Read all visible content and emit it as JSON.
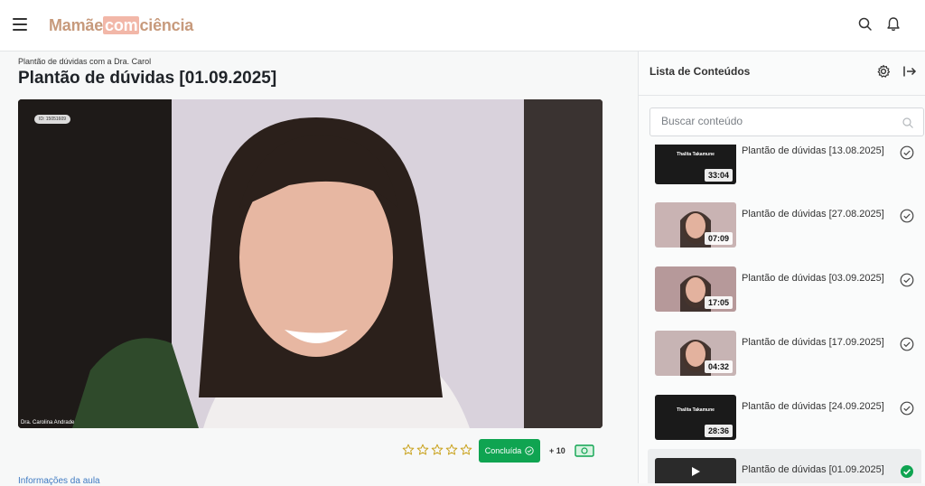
{
  "header": {
    "logo_part1": "Mamãe",
    "logo_part2": "com",
    "logo_part3": "ciência"
  },
  "lesson": {
    "breadcrumb": "Plantão de dúvidas com a Dra. Carol",
    "title": "Plantão de dúvidas [01.09.2025]",
    "video_id_badge": "ID: 15051609",
    "video_speaker_name": "Dra. Carolina Andrade",
    "rating": 0,
    "rating_max": 5,
    "done_label": "Concluída",
    "points_label": "+ 10",
    "info_link": "Informações da aula"
  },
  "sidebar": {
    "title": "Lista de Conteúdos",
    "search_placeholder": "Buscar conteúdo",
    "items": [
      {
        "title": "Plantão de dúvidas [13.08.2025]",
        "duration": "33:04",
        "thumb_caption": "Thalita Takamune",
        "done": true,
        "active": false
      },
      {
        "title": "Plantão de dúvidas [27.08.2025]",
        "duration": "07:09",
        "thumb_caption": "",
        "done": true,
        "active": false
      },
      {
        "title": "Plantão de dúvidas [03.09.2025]",
        "duration": "17:05",
        "thumb_caption": "",
        "done": true,
        "active": false
      },
      {
        "title": "Plantão de dúvidas [17.09.2025]",
        "duration": "04:32",
        "thumb_caption": "",
        "done": true,
        "active": false
      },
      {
        "title": "Plantão de dúvidas [24.09.2025]",
        "duration": "28:36",
        "thumb_caption": "Thalita Takamune",
        "done": true,
        "active": false
      },
      {
        "title": "Plantão de dúvidas [01.09.2025]",
        "duration": "",
        "thumb_caption": "",
        "done": true,
        "active": true
      }
    ]
  },
  "colors": {
    "accent_green": "#0fa451",
    "logo": "#c79a7c",
    "link": "#3f7ac2"
  }
}
